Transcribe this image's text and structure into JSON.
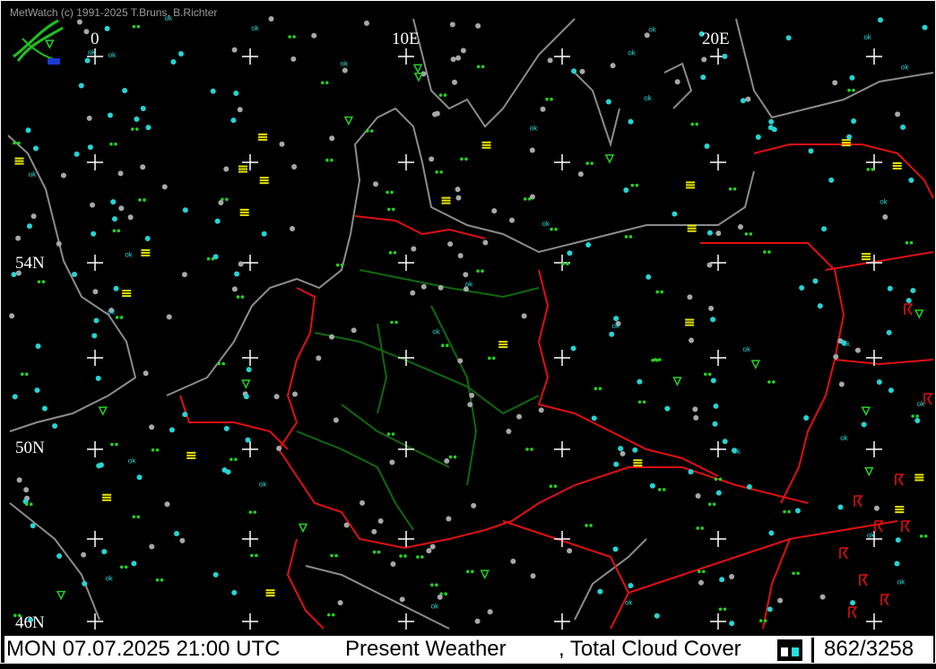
{
  "app": {
    "credit": "MetWatch  (c) 1991-2025 T.Bruns, B.Richter"
  },
  "map": {
    "longitude_labels": [
      "0",
      "10E",
      "20E"
    ],
    "latitude_labels": [
      "54N",
      "50N",
      "46N"
    ],
    "colors": {
      "background": "#000000",
      "coast": "#8c8c8c",
      "border_country": "#e01010",
      "border_state": "#0e6a0e",
      "grid": "#ffffff",
      "station_clear": "#26d4d4",
      "station_other": "#a8a8a8",
      "rain": "#24d224",
      "fog": "#e8e800",
      "thunder": "#e01010"
    },
    "symbol_legend": {
      "ok": "ok",
      "icons": [
        "weather-station-icon",
        "rain-dot-icon",
        "fog-bars-icon",
        "thunderstorm-icon",
        "cloud-cover-circle-icon"
      ]
    }
  },
  "status": {
    "datetime": "MON 07.07.2025 21:00 UTC",
    "product": "Present Weather",
    "overlay": ", Total Cloud Cover",
    "count": "862/3258"
  }
}
